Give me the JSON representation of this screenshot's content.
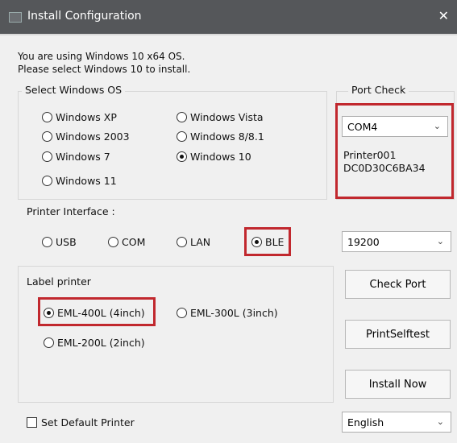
{
  "window": {
    "title": "Install Configuration",
    "close_glyph": "✕"
  },
  "info": {
    "line1": "You are using Windows 10 x64 OS.",
    "line2": "Please select Windows 10 to install."
  },
  "os_group": {
    "label": "Select Windows OS",
    "options": [
      {
        "label": "Windows XP",
        "selected": false
      },
      {
        "label": "Windows Vista",
        "selected": false
      },
      {
        "label": "Windows 2003",
        "selected": false
      },
      {
        "label": "Windows 8/8.1",
        "selected": false
      },
      {
        "label": "Windows 7",
        "selected": false
      },
      {
        "label": "Windows 10",
        "selected": true
      },
      {
        "label": "Windows 11",
        "selected": false
      }
    ]
  },
  "port_check": {
    "label": "Port Check",
    "port_select": "COM4",
    "device_line1": "Printer001",
    "device_line2": "DC0D30C6BA34"
  },
  "printer_interface": {
    "label": "Printer Interface :",
    "options": [
      {
        "label": "USB",
        "selected": false
      },
      {
        "label": "COM",
        "selected": false
      },
      {
        "label": "LAN",
        "selected": false
      },
      {
        "label": "BLE",
        "selected": true
      }
    ]
  },
  "baud_select": "19200",
  "label_printer": {
    "label": "Label printer",
    "options": [
      {
        "label": "EML-400L (4inch)",
        "selected": true
      },
      {
        "label": "EML-300L (3inch)",
        "selected": false
      },
      {
        "label": "EML-200L (2inch)",
        "selected": false
      }
    ]
  },
  "buttons": {
    "check_port": "Check Port",
    "print_selftest": "PrintSelftest",
    "install_now": "Install Now"
  },
  "set_default_printer": {
    "label": "Set Default Printer",
    "checked": false
  },
  "language_select": "English",
  "colors": {
    "titlebar": "#55575a",
    "highlight": "#c1282e",
    "window_bg": "#f0f0f0"
  }
}
